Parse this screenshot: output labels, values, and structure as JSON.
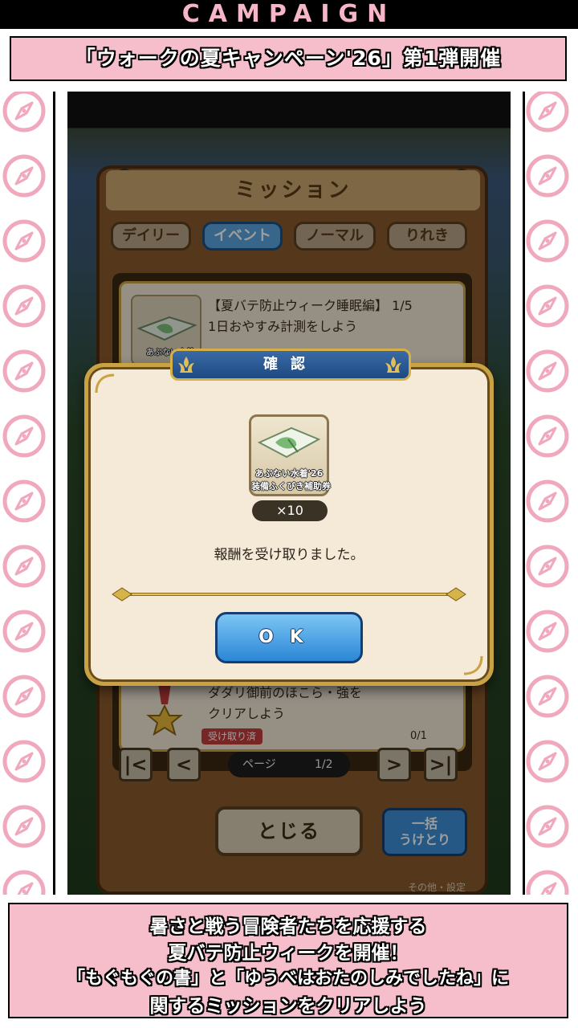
{
  "campaign_label": "CAMPAIGN",
  "banner_title": "「ウォークの夏キャンペーン'26」第1弾開催",
  "game": {
    "panel_title": "ミッション",
    "tabs": [
      {
        "label": "デイリー"
      },
      {
        "label": "イベント"
      },
      {
        "label": "ノーマル"
      },
      {
        "label": "りれき"
      }
    ],
    "active_tab": "イベント",
    "missions": [
      {
        "title": "【夏バテ防止ウィーク睡眠編】 1/5",
        "description": "1日おやすみ計測をしよう",
        "item_caption": "あぶない水着"
      },
      {
        "title": "ダダリ御前のほこら・強を",
        "description": "クリアしよう",
        "badge": "受け取り済",
        "progress": "0/1"
      }
    ],
    "pagination": {
      "first": "|<",
      "prev": "<",
      "label": "ページ",
      "value": "1/2",
      "next": ">",
      "last": ">|"
    },
    "close_label": "とじる",
    "bulk_receive_line1": "一括",
    "bulk_receive_line2": "うけとり",
    "footer_hint": "その他・設定"
  },
  "dialog": {
    "title": "確認",
    "item_line1": "あぶない水着'26",
    "item_line2": "装備ふくびき補助券",
    "quantity": "×10",
    "message": "報酬を受け取りました。",
    "ok_label": "OK"
  },
  "caption": {
    "line1": "暑さと戦う冒険者たちを応援する",
    "line2": "夏バテ防止ウィークを開催！",
    "line3": "「もぐもぐの書」と「ゆうべはおたのしみでしたね」に",
    "line4": "関するミッションをクリアしよう"
  },
  "colors": {
    "brand_pink": "#f6bdcb",
    "compass_pink": "#f0a8bd",
    "ok_blue": "#2b86d6",
    "gold_border": "#c9a244"
  }
}
